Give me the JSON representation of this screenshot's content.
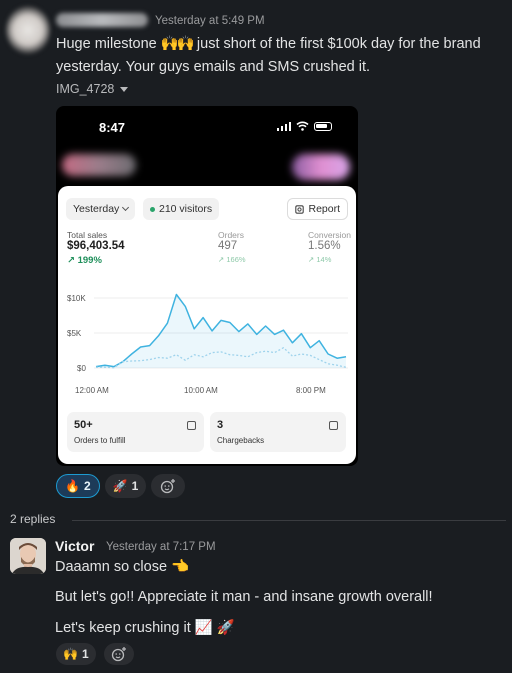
{
  "message1": {
    "timestamp": "Yesterday at 5:49 PM",
    "text_part1": "Huge milestone ",
    "emoji": "🙌🙌",
    "text_part2": " just short of the first $100k day for the brand yesterday. Your guys emails and SMS crushed it.",
    "attachment_name": "IMG_4728"
  },
  "phone": {
    "time": "8:47",
    "date_filter": "Yesterday",
    "visitors": "210 visitors",
    "report_button": "Report",
    "metrics": [
      {
        "label": "Total sales",
        "value": "$96,403.54",
        "growth": "↗ 199%"
      },
      {
        "label": "Orders",
        "value": "497",
        "growth": "↗ 166%"
      },
      {
        "label": "Conversion",
        "value": "1.56%",
        "growth": "↗ 14%"
      }
    ],
    "y_ticks": [
      "$10K",
      "$5K",
      "$0"
    ],
    "x_ticks": [
      "12:00 AM",
      "10:00 AM",
      "8:00 PM"
    ],
    "tiles": [
      {
        "value": "50+",
        "label": "Orders to fulfill"
      },
      {
        "value": "3",
        "label": "Chargebacks"
      }
    ]
  },
  "chart_data": {
    "type": "line",
    "ylim": [
      0,
      10000
    ],
    "series": [
      {
        "values": [
          200,
          400,
          200,
          900,
          2000,
          3000,
          3200,
          4600,
          6400,
          10500,
          8800,
          5600,
          7200,
          5300,
          6800,
          6500,
          5200,
          6300,
          4800,
          6000,
          4800,
          5400,
          3600,
          4900,
          2900,
          3900,
          2000,
          1400,
          1600
        ]
      },
      {
        "values": [
          100,
          120,
          50,
          900,
          1000,
          1050,
          1200,
          1500,
          1400,
          1900,
          1100,
          1900,
          1600,
          2200,
          2300,
          1900,
          1800,
          1600,
          2200,
          2400,
          2200,
          2900,
          1700,
          2000,
          1800,
          1200,
          600,
          400,
          100
        ]
      }
    ]
  },
  "reactions1": [
    {
      "emoji": "🔥",
      "count": "2"
    },
    {
      "emoji": "🚀",
      "count": "1"
    }
  ],
  "thread": {
    "replies_label": "2 replies",
    "author": "Victor",
    "timestamp": "Yesterday at 7:17 PM",
    "messages": [
      "Daaamn so close 👈",
      "But let's go!! Appreciate it man - and insane growth overall!",
      "Let's keep crushing it 📈 🚀"
    ],
    "reaction_emoji": "🙌",
    "reaction_count": "1"
  }
}
